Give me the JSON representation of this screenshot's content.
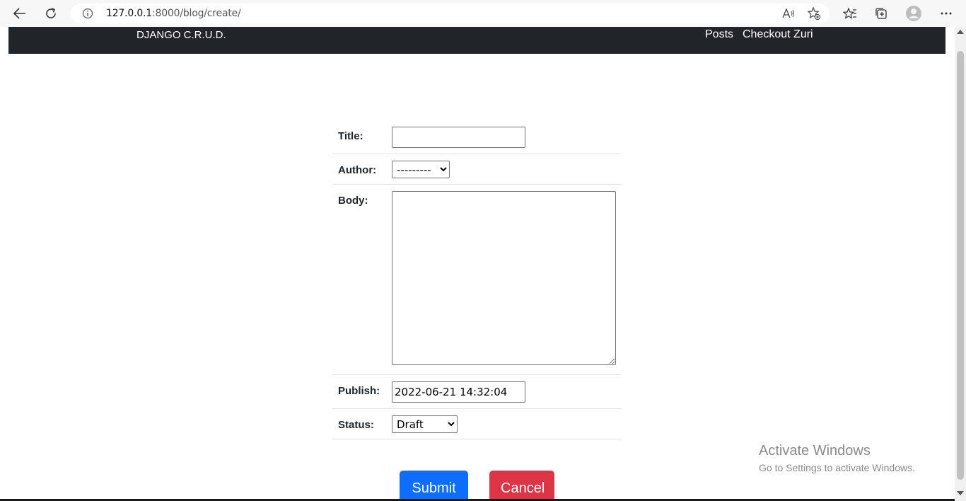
{
  "browser": {
    "url_host": "127.0.0.1",
    "url_path": ":8000/blog/create/",
    "icons": [
      "back-icon",
      "refresh-icon",
      "info-icon",
      "read-aloud-icon",
      "add-favorite-icon",
      "favorites-icon",
      "collections-icon",
      "profile-icon",
      "more-icon"
    ]
  },
  "navbar": {
    "brand": "DJANGO C.R.U.D.",
    "links": [
      "Posts",
      "Checkout Zuri"
    ]
  },
  "form": {
    "title_label": "Title:",
    "title_value": "",
    "author_label": "Author:",
    "author_selected": "---------",
    "body_label": "Body:",
    "body_value": "",
    "publish_label": "Publish:",
    "publish_value": "2022-06-21 14:32:04",
    "status_label": "Status:",
    "status_selected": "Draft"
  },
  "buttons": {
    "submit": "Submit",
    "cancel": "Cancel"
  },
  "watermark": {
    "line1": "Activate Windows",
    "line2": "Go to Settings to activate Windows."
  }
}
